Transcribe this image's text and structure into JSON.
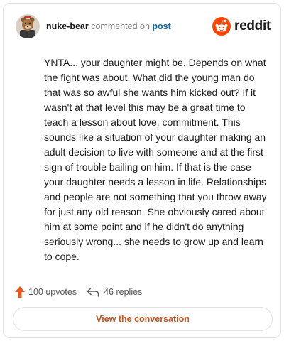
{
  "header": {
    "username": "nuke-bear",
    "action_text": "commented on",
    "post_link": "post",
    "brand": "reddit"
  },
  "comment": {
    "body": "YNTA... your daughter might be. Depends on what the fight was about. What did the young man do that was so awful she wants him kicked out? If it wasn't at that level this may be a great time to teach a lesson about love, commitment. This sounds like a situation of your daughter making an adult decision to live with someone and at the first sign of trouble bailing on him. If that is the case your daughter needs a lesson in life. Relationships and people are not something that you throw away for just any old reason. She obviously cared about him at some point and if he didn't do anything seriously wrong... she needs to grow up and learn to cope."
  },
  "actions": {
    "upvotes": "100 upvotes",
    "replies": "46 replies"
  },
  "footer": {
    "view_label": "View the conversation"
  },
  "colors": {
    "brand_orange": "#ff4500",
    "upvote_orange": "#e8571e",
    "link_blue": "#0f64a5",
    "button_text": "#c7501e"
  },
  "icons": {
    "avatar": "user-avatar-bear",
    "logo": "reddit-snoo-icon",
    "upvote": "upvote-arrow-icon",
    "reply": "reply-arrow-icon"
  }
}
